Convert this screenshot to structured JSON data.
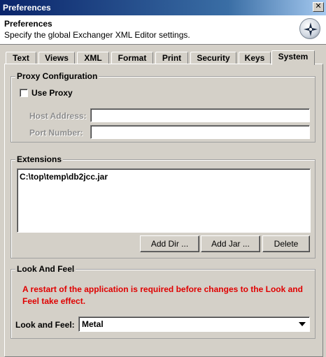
{
  "window": {
    "title": "Preferences",
    "close_glyph": "✕",
    "header_title": "Preferences",
    "header_subtitle": "Specify the global Exchanger XML Editor settings.",
    "header_icon": "compass-icon"
  },
  "tabs": [
    {
      "label": "Text"
    },
    {
      "label": "Views"
    },
    {
      "label": "XML"
    },
    {
      "label": "Format"
    },
    {
      "label": "Print"
    },
    {
      "label": "Security"
    },
    {
      "label": "Keys"
    },
    {
      "label": "System",
      "active": true
    }
  ],
  "proxy": {
    "group_label": "Proxy Configuration",
    "use_proxy_label": "Use Proxy",
    "use_proxy_checked": false,
    "host_label": "Host Address:",
    "host_value": "",
    "port_label": "Port Number:",
    "port_value": ""
  },
  "extensions": {
    "group_label": "Extensions",
    "items": [
      "C:\\top\\temp\\db2jcc.jar"
    ],
    "add_dir_label": "Add Dir ...",
    "add_jar_label": "Add Jar ...",
    "delete_label": "Delete"
  },
  "look_and_feel": {
    "group_label": "Look And Feel",
    "warning": "A restart of the application is required before changes to the Look and Feel take effect.",
    "field_label": "Look and Feel:",
    "selected": "Metal"
  },
  "colors": {
    "warning": "#e00000",
    "titlebar": "#0a246a"
  }
}
